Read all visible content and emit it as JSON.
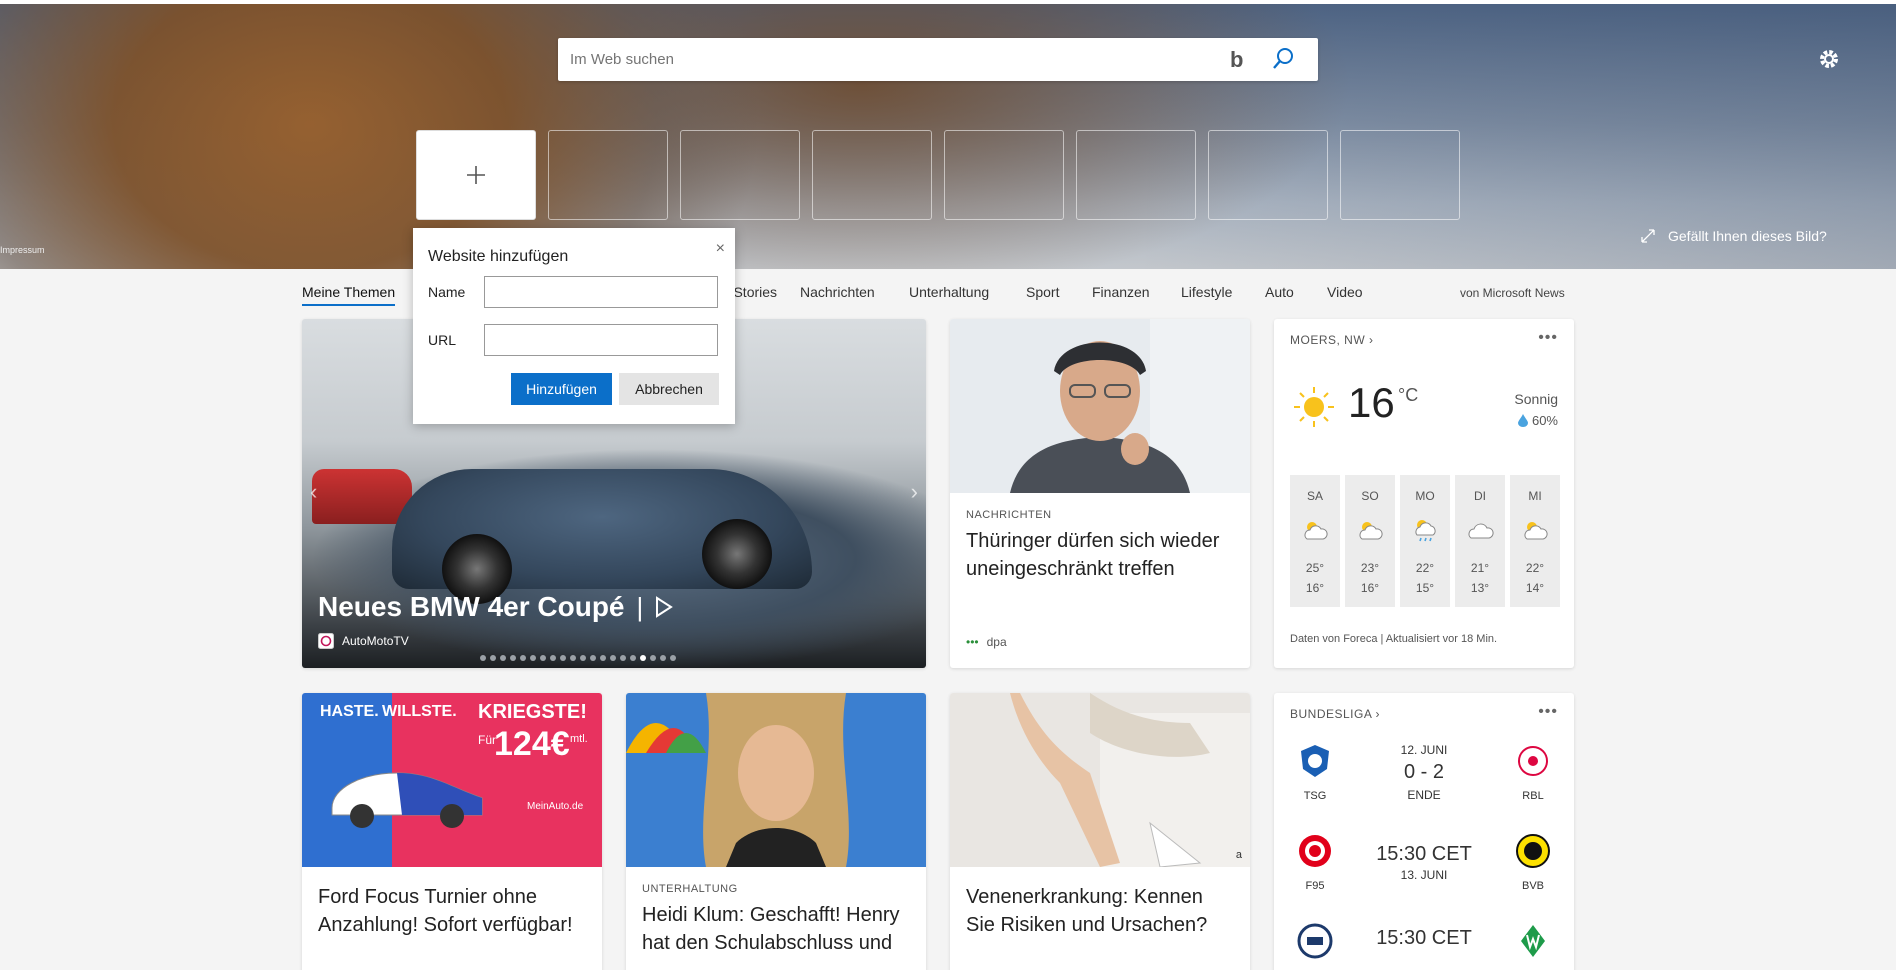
{
  "hero": {
    "impressum": "Impressum",
    "feedback": "Gefällt Ihnen dieses Bild?"
  },
  "search": {
    "placeholder": "Im Web suchen",
    "bing_glyph": "b"
  },
  "popup": {
    "title": "Website hinzufügen",
    "close_glyph": "×",
    "name_label": "Name",
    "url_label": "URL",
    "name_value": "",
    "url_value": "",
    "add_button": "Hinzufügen",
    "cancel_button": "Abbrechen"
  },
  "nav": {
    "tabs": [
      "Meine Themen",
      "Top Stories",
      "Nachrichten",
      "Unterhaltung",
      "Sport",
      "Finanzen",
      "Lifestyle",
      "Auto",
      "Video"
    ],
    "source": "von Microsoft News"
  },
  "hero_card": {
    "headline": "Neues BMW 4er Coupé",
    "publisher": "AutoMotoTV",
    "slides_total": 20,
    "slide_active": 17
  },
  "news": [
    {
      "category": "NACHRICHTEN",
      "title": "Thüringer dürfen sich wieder uneingeschränkt treffen",
      "source": "dpa"
    },
    {
      "category": "",
      "title": "Ford Focus Turnier ohne Anzahlung! Sofort verfügbar!",
      "source": "",
      "ad_text": {
        "a": "HASTE.",
        "b": "WILLSTE.",
        "c": "KRIEGSTE!",
        "d": "Für",
        "e": "124€",
        "f": "mtl.",
        "g": "MeinAuto.de"
      }
    },
    {
      "category": "UNTERHALTUNG",
      "title": "Heidi Klum: Geschafft! Henry hat den Schulabschluss und",
      "source": ""
    },
    {
      "category": "",
      "title": "Venenerkrankung: Kennen Sie Risiken und Ursachen?",
      "source": "",
      "badge": "a"
    }
  ],
  "weather": {
    "location": "MOERS, NW",
    "temp": "16",
    "unit": "°C",
    "condition": "Sonnig",
    "rain": "60%",
    "forecast": [
      {
        "day": "SA",
        "hi": "25°",
        "lo": "16°",
        "icon": "partly-cloudy-icon"
      },
      {
        "day": "SO",
        "hi": "23°",
        "lo": "16°",
        "icon": "partly-cloudy-icon"
      },
      {
        "day": "MO",
        "hi": "22°",
        "lo": "15°",
        "icon": "rain-icon"
      },
      {
        "day": "DI",
        "hi": "21°",
        "lo": "13°",
        "icon": "cloud-icon"
      },
      {
        "day": "MI",
        "hi": "22°",
        "lo": "14°",
        "icon": "partly-cloudy-icon"
      }
    ],
    "footer": "Daten von Foreca | Aktualisiert vor 18 Min."
  },
  "sports": {
    "league": "BUNDESLIGA",
    "matches": [
      {
        "home": "TSG",
        "away": "RBL",
        "top": "12. JUNI",
        "main": "0 - 2",
        "sub": "ENDE",
        "home_color": "#1a5fb4",
        "away_color": "#dd0741"
      },
      {
        "home": "F95",
        "away": "BVB",
        "top": "",
        "main": "15:30 CET",
        "sub": "13. JUNI",
        "home_color": "#e1001a",
        "away_color": "#fde100"
      },
      {
        "home": "",
        "away": "",
        "top": "",
        "main": "15:30 CET",
        "sub": "",
        "home_color": "#1d3a6b",
        "away_color": "#1e9b4a"
      }
    ]
  },
  "colors": {
    "accent": "#0b6fc9"
  }
}
